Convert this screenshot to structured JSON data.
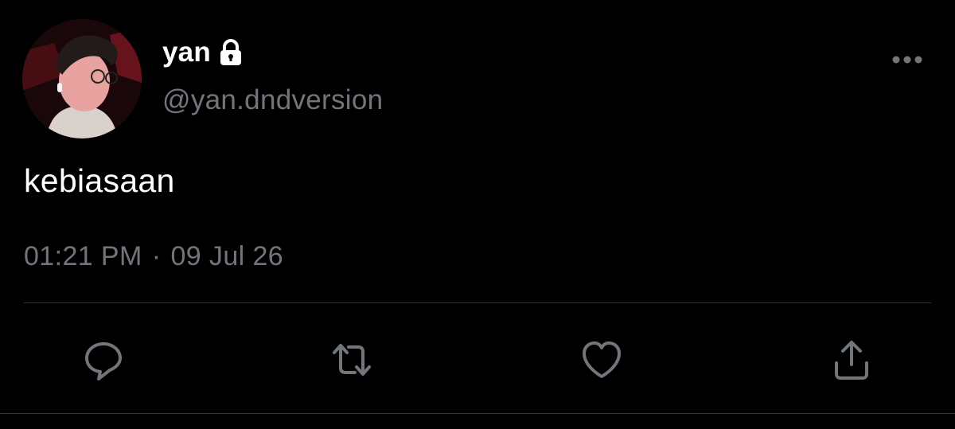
{
  "theme": {
    "background": "#000000",
    "text_primary": "#ffffff",
    "text_secondary": "#71767b",
    "divider": "#2f3336",
    "icon": "#71767b"
  },
  "author": {
    "display_name": "yan",
    "handle": "@yan.dndversion",
    "protected_icon": "lock-icon",
    "avatar_icon": "profile-photo"
  },
  "tweet": {
    "text": "kebiasaan",
    "time": "01:21 PM",
    "separator": "·",
    "date": "09 Jul 26"
  },
  "menu": {
    "icon": "more-horizontal-icon"
  },
  "actions": [
    {
      "name": "reply",
      "icon": "reply-icon"
    },
    {
      "name": "retweet",
      "icon": "retweet-icon"
    },
    {
      "name": "like",
      "icon": "heart-icon"
    },
    {
      "name": "share",
      "icon": "share-icon"
    }
  ]
}
